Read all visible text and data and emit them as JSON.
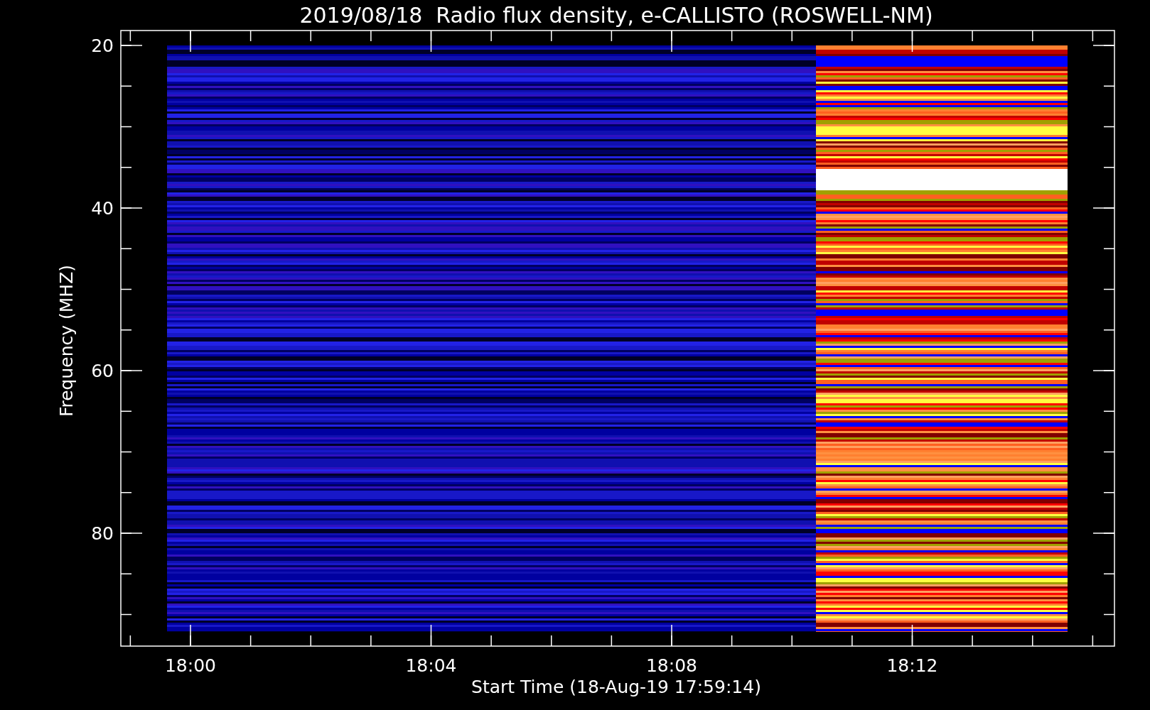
{
  "title": "2019/08/18  Radio flux density, e-CALLISTO (ROSWELL-NM)",
  "plot": {
    "ylabel": "Frequency (MHZ)",
    "xlabel": "Start Time (18-Aug-19 17:59:14)",
    "yticks": [
      "20",
      "40",
      "60",
      "80"
    ],
    "xticks": [
      "18:00",
      "18:04",
      "18:08",
      "18:12"
    ]
  }
}
